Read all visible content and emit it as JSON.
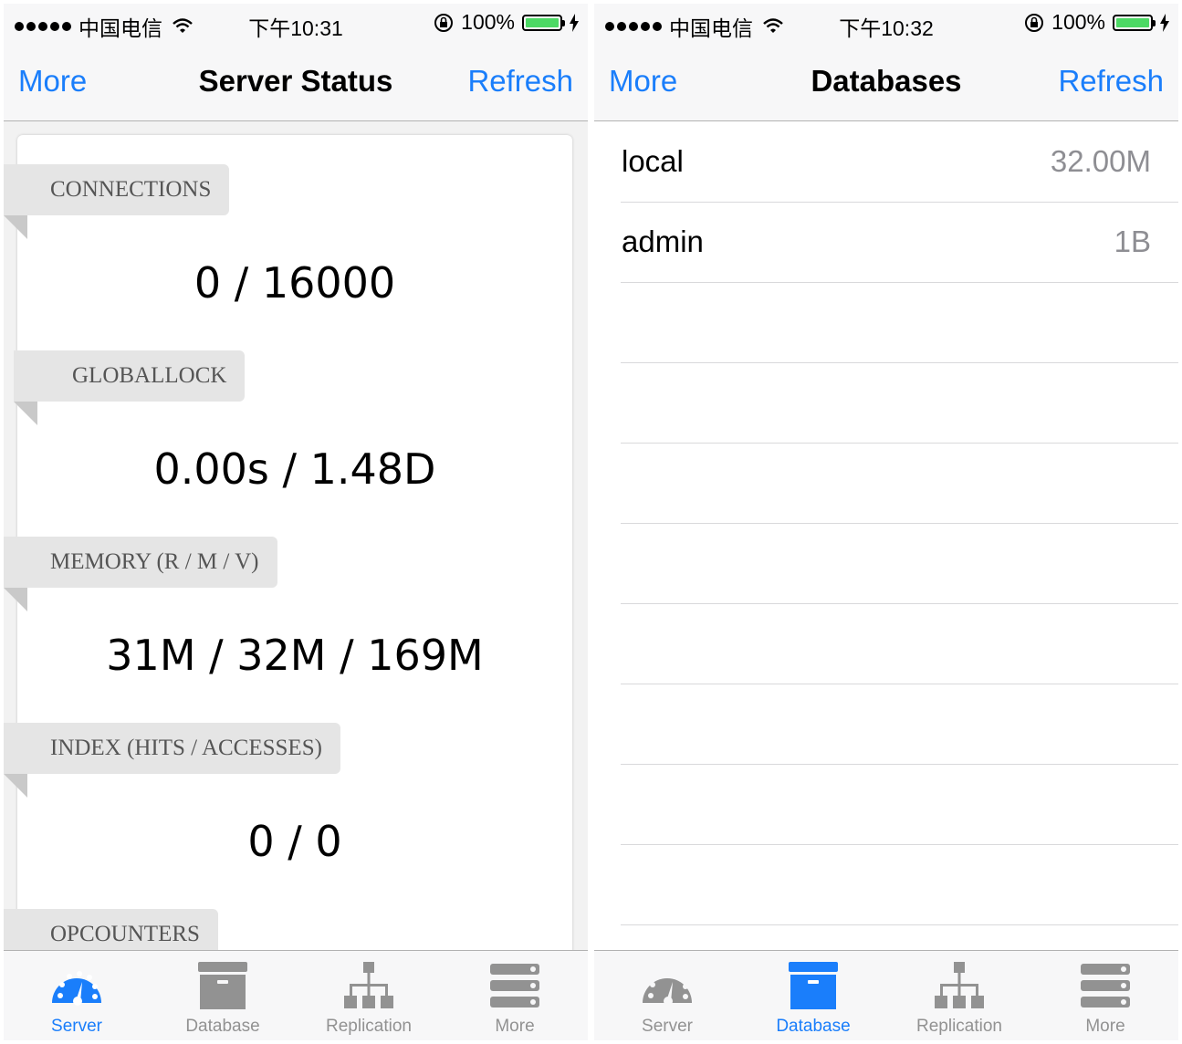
{
  "left": {
    "status": {
      "carrier": "中国电信",
      "time": "下午10:31",
      "battery": "100%"
    },
    "nav": {
      "left": "More",
      "title": "Server Status",
      "right": "Refresh"
    },
    "metrics": [
      {
        "label": "CONNECTIONS",
        "value": "0 / 16000"
      },
      {
        "label": "GLOBALLOCK",
        "value": "0.00s / 1.48D"
      },
      {
        "label": "MEMORY (R / M / V)",
        "value": "31M / 32M / 169M"
      },
      {
        "label": "INDEX (HITS / ACCESSES)",
        "value": "0 / 0"
      },
      {
        "label": "OPCOUNTERS",
        "value": ""
      }
    ],
    "tabs": [
      {
        "label": "Server",
        "icon": "speedometer-icon",
        "active": true
      },
      {
        "label": "Database",
        "icon": "archive-box-icon",
        "active": false
      },
      {
        "label": "Replication",
        "icon": "hierarchy-icon",
        "active": false
      },
      {
        "label": "More",
        "icon": "server-rack-icon",
        "active": false
      }
    ]
  },
  "right": {
    "status": {
      "carrier": "中国电信",
      "time": "下午10:32",
      "battery": "100%"
    },
    "nav": {
      "left": "More",
      "title": "Databases",
      "right": "Refresh"
    },
    "databases": [
      {
        "name": "local",
        "size": "32.00M"
      },
      {
        "name": "admin",
        "size": "1B"
      }
    ],
    "tabs": [
      {
        "label": "Server",
        "icon": "speedometer-icon",
        "active": false
      },
      {
        "label": "Database",
        "icon": "archive-box-icon",
        "active": true
      },
      {
        "label": "Replication",
        "icon": "hierarchy-icon",
        "active": false
      },
      {
        "label": "More",
        "icon": "server-rack-icon",
        "active": false
      }
    ]
  },
  "colors": {
    "accent": "#1a7efb",
    "inactive_tab": "#929292",
    "battery": "#4cd964",
    "ribbon": "#e5e5e5"
  }
}
